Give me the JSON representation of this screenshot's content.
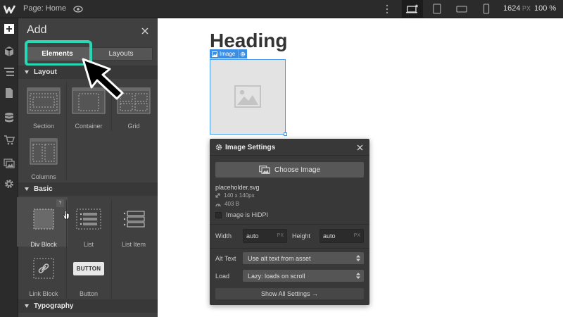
{
  "topbar": {
    "page_label": "Page: Home",
    "width_value": "1624",
    "width_unit": "PX",
    "zoom": "100 %"
  },
  "add_panel": {
    "title": "Add",
    "tabs": [
      {
        "label": "Elements",
        "active": true
      },
      {
        "label": "Layouts",
        "active": false
      }
    ],
    "sections": {
      "layout": {
        "label": "Layout",
        "items": [
          {
            "label": "Section"
          },
          {
            "label": "Container"
          },
          {
            "label": "Grid"
          },
          {
            "label": "Columns"
          }
        ]
      },
      "basic": {
        "label": "Basic",
        "items": [
          {
            "label": "Div Block"
          },
          {
            "label": "List"
          },
          {
            "label": "List Item"
          },
          {
            "label": "Link Block"
          },
          {
            "label": "Button",
            "chip": "BUTTON"
          }
        ],
        "help_badge": "?"
      },
      "typography": {
        "label": "Typography"
      }
    }
  },
  "canvas": {
    "heading": "Heading",
    "selected_tag": "Image"
  },
  "image_settings": {
    "title": "Image Settings",
    "choose_button": "Choose Image",
    "file_name": "placeholder.svg",
    "dimensions": "140 x 140px",
    "file_size": "403 B",
    "hidpi_label": "Image is HiDPI",
    "width_label": "Width",
    "width_value": "auto",
    "width_unit": "PX",
    "height_label": "Height",
    "height_value": "auto",
    "height_unit": "PX",
    "alt_label": "Alt Text",
    "alt_value": "Use alt text from asset",
    "load_label": "Load",
    "load_value": "Lazy: loads on scroll",
    "show_all": "Show All Settings →"
  },
  "colors": {
    "accent_highlight": "#2ad6b3",
    "selection_blue": "#3b8ee6",
    "panel_bg": "#404040",
    "topbar_bg": "#2b2b2b"
  }
}
